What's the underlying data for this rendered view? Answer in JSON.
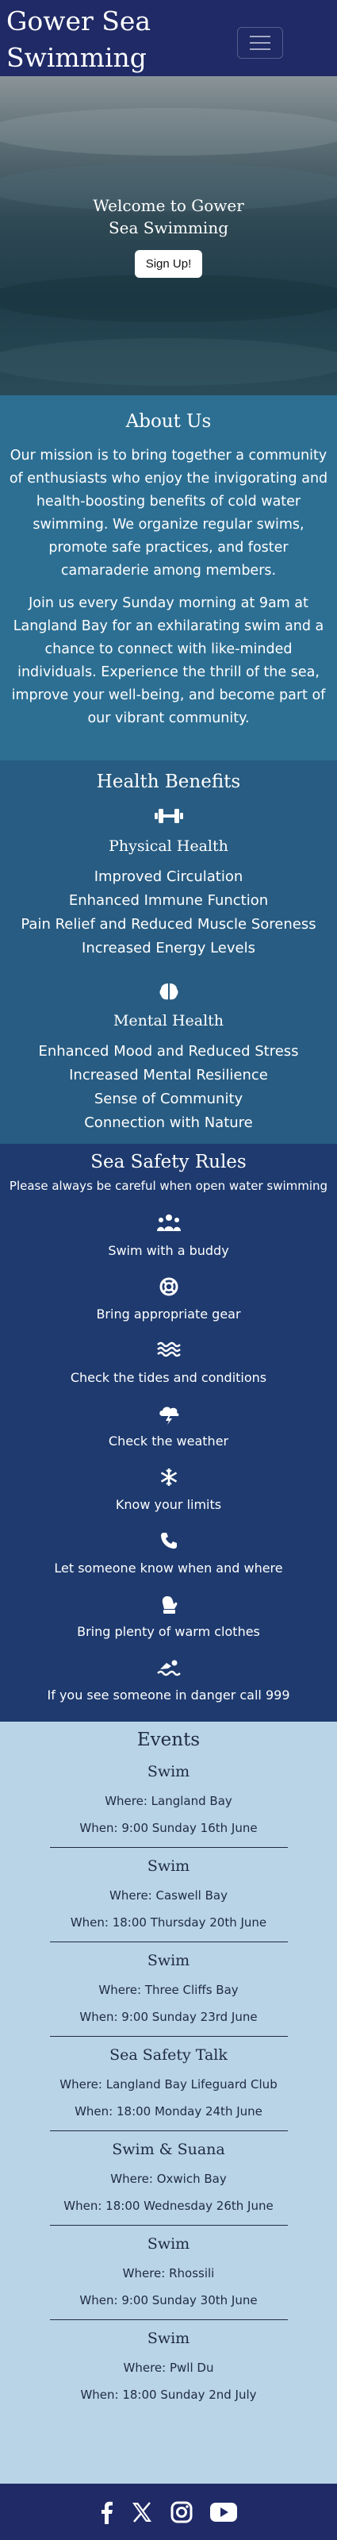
{
  "navbar": {
    "brand": "Gower Sea Swimming",
    "toggle_icon": "hamburger-menu-icon"
  },
  "hero": {
    "title": "Welcome to Gower Sea Swimming",
    "button_label": "Sign Up!"
  },
  "about": {
    "heading": "About Us",
    "paragraphs": [
      "Our mission is to bring together a community of enthusiasts who enjoy the invigorating and health-boosting benefits of cold water swimming. We organize regular swims, promote safe practices, and foster camaraderie among members.",
      "Join us every Sunday morning at 9am at Langland Bay for an exhilarating swim and a chance to connect with like-minded individuals. Experience the thrill of the sea, improve your well-being, and become part of our vibrant community."
    ]
  },
  "health": {
    "heading": "Health Benefits",
    "sections": [
      {
        "icon": "dumbbell-icon",
        "title": "Physical Health",
        "items": [
          "Improved Circulation",
          "Enhanced Immune Function",
          "Pain Relief and Reduced Muscle Soreness",
          "Increased Energy Levels"
        ]
      },
      {
        "icon": "brain-icon",
        "title": "Mental Health",
        "items": [
          "Enhanced Mood and Reduced Stress",
          "Increased Mental Resilience",
          "Sense of Community",
          "Connection with Nature"
        ]
      }
    ]
  },
  "safety": {
    "heading": "Sea Safety Rules",
    "subtitle": "Please always be careful when open water swimming",
    "rules": [
      {
        "icon": "people-group-icon",
        "label": "Swim with a buddy"
      },
      {
        "icon": "life-ring-icon",
        "label": "Bring appropriate gear"
      },
      {
        "icon": "water-icon",
        "label": "Check the tides and conditions"
      },
      {
        "icon": "cloud-bolt-icon",
        "label": "Check the weather"
      },
      {
        "icon": "snowflake-icon",
        "label": "Know your limits"
      },
      {
        "icon": "phone-icon",
        "label": "Let someone know when and where"
      },
      {
        "icon": "mitten-icon",
        "label": "Bring plenty of warm clothes"
      },
      {
        "icon": "swimmer-icon",
        "label": "If you see someone in danger call 999"
      }
    ]
  },
  "events": {
    "heading": "Events",
    "items": [
      {
        "title": "Swim",
        "where": "Where: Langland Bay",
        "when": "When: 9:00 Sunday 16th June"
      },
      {
        "title": "Swim",
        "where": "Where: Caswell Bay",
        "when": "When: 18:00 Thursday 20th June"
      },
      {
        "title": "Swim",
        "where": "Where: Three Cliffs Bay",
        "when": "When: 9:00 Sunday 23rd June"
      },
      {
        "title": "Sea Safety Talk",
        "where": "Where: Langland Bay Lifeguard Club",
        "when": "When: 18:00 Monday 24th June"
      },
      {
        "title": "Swim & Suana",
        "where": "Where: Oxwich Bay",
        "when": "When: 18:00 Wednesday 26th June"
      },
      {
        "title": "Swim",
        "where": "Where: Rhossili",
        "when": "When: 9:00 Sunday 30th June"
      },
      {
        "title": "Swim",
        "where": "Where: Pwll Du",
        "when": "When: 18:00 Sunday 2nd July"
      }
    ]
  },
  "footer": {
    "icons": [
      "facebook-icon",
      "x-twitter-icon",
      "instagram-icon",
      "youtube-icon"
    ]
  }
}
